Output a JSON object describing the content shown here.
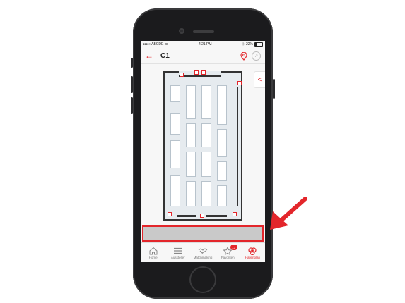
{
  "status": {
    "carrier": "ABCDE",
    "time": "4:21 PM",
    "battery": "22%"
  },
  "nav": {
    "back": "←",
    "title": "C1",
    "side_toggle": "<"
  },
  "tabs": [
    {
      "label": "Home",
      "icon": "home-icon"
    },
    {
      "label": "Aussteller",
      "icon": "list-icon"
    },
    {
      "label": "Matchmaking",
      "icon": "handshake-icon"
    },
    {
      "label": "Favoriten",
      "icon": "star-icon",
      "badge": "13"
    },
    {
      "label": "Hallenplan",
      "icon": "hallplan-icon",
      "active": true
    }
  ],
  "colors": {
    "accent": "#e3262b",
    "highlight_box": "#c9c9c9"
  }
}
